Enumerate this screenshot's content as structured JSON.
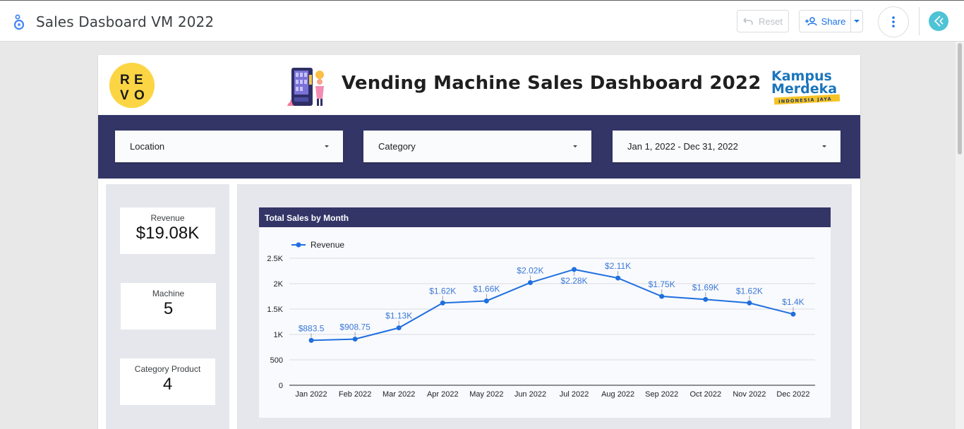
{
  "app": {
    "title": "Sales Dasboard VM 2022",
    "reset_label": "Reset",
    "share_label": "Share"
  },
  "report": {
    "title": "Vending Machine Sales Dashboard 2022",
    "revo_logo_letters": [
      "R",
      "E",
      "V",
      "O"
    ],
    "kampus_logo": {
      "line1": "Kampus",
      "line2": "Merdeka",
      "tagline": "INDONESIA JAYA"
    }
  },
  "filters": {
    "location": "Location",
    "category": "Category",
    "date_range": "Jan 1, 2022 - Dec 31, 2022"
  },
  "kpis": {
    "revenue": {
      "label": "Revenue",
      "value": "$19.08K"
    },
    "machine": {
      "label": "Machine",
      "value": "5"
    },
    "category_product": {
      "label": "Category Product",
      "value": "4"
    }
  },
  "chart_data": {
    "type": "line",
    "title": "Total Sales by Month",
    "xlabel": "",
    "ylabel": "",
    "categories": [
      "Jan 2022",
      "Feb 2022",
      "Mar 2022",
      "Apr 2022",
      "May 2022",
      "Jun 2022",
      "Jul 2022",
      "Aug 2022",
      "Sep 2022",
      "Oct 2022",
      "Nov 2022",
      "Dec 2022"
    ],
    "series": [
      {
        "name": "Revenue",
        "values": [
          883.5,
          908.75,
          1130,
          1620,
          1660,
          2020,
          2280,
          2110,
          1750,
          1690,
          1620,
          1400
        ],
        "data_labels": [
          "$883.5",
          "$908.75",
          "$1.13K",
          "$1.62K",
          "$1.66K",
          "$2.02K",
          "$2.28K",
          "$2.11K",
          "$1.75K",
          "$1.69K",
          "$1.62K",
          "$1.4K"
        ]
      }
    ],
    "y_ticks": [
      "0",
      "500",
      "1K",
      "1.5K",
      "2K",
      "2.5K"
    ],
    "ylim": [
      0,
      2500
    ],
    "grid": true,
    "legend_position": "top-left",
    "colors": {
      "line": "#1f6fe0",
      "label": "#3b78d8"
    }
  },
  "colors": {
    "band": "#333567",
    "panel": "#e6e7ec",
    "accent": "#1a73e8"
  }
}
